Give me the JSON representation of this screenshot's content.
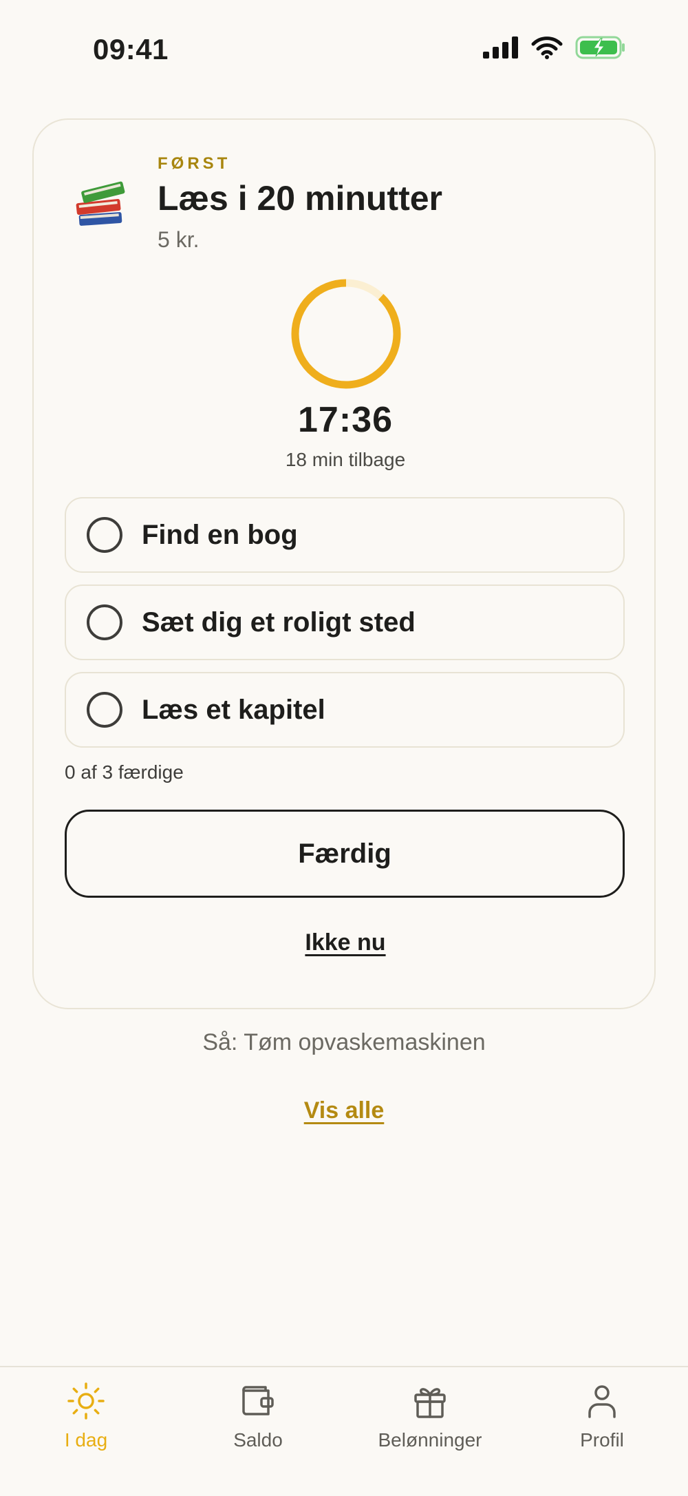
{
  "status_bar": {
    "time": "09:41"
  },
  "task": {
    "eyebrow": "FØRST",
    "title": "Læs i 20 minutter",
    "reward": "5 kr.",
    "timer": {
      "value": "17:36",
      "remaining": "18 min tilbage",
      "progress": 0.88
    },
    "steps": [
      {
        "label": "Find en bog",
        "done": false
      },
      {
        "label": "Sæt dig et roligt sted",
        "done": false
      },
      {
        "label": "Læs et kapitel",
        "done": false
      }
    ],
    "steps_progress": "0 af 3 færdige",
    "done_label": "Færdig",
    "skip_label": "Ikke nu"
  },
  "next_task": "Så: Tøm opvaskemaskinen",
  "show_all_label": "Vis alle",
  "tab_bar": {
    "tabs": [
      {
        "label": "I dag",
        "icon": "sun-icon",
        "active": true
      },
      {
        "label": "Saldo",
        "icon": "wallet-icon",
        "active": false
      },
      {
        "label": "Belønninger",
        "icon": "gift-icon",
        "active": false
      },
      {
        "label": "Profil",
        "icon": "person-icon",
        "active": false
      }
    ]
  },
  "colors": {
    "accent": "#E8AE12",
    "eyebrow": "#A8860F",
    "link": "#B48A12",
    "background": "#FBF9F5",
    "ring_track": "#FBEFD2",
    "battery": "#3DBE4D"
  }
}
